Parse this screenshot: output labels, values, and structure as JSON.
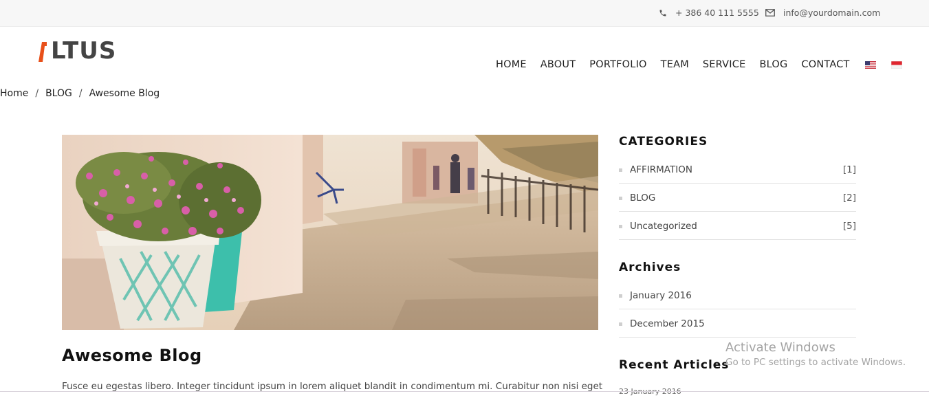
{
  "topbar": {
    "phone": "+ 386 40 111 5555",
    "email": "info@yourdomain.com"
  },
  "logo": {
    "text": "LTUS"
  },
  "nav": {
    "items": [
      "HOME",
      "ABOUT",
      "PORTFOLIO",
      "TEAM",
      "SERVICE",
      "BLOG",
      "CONTACT"
    ]
  },
  "breadcrumb": {
    "home": "Home",
    "section": "BLOG",
    "current": "Awesome Blog",
    "separator": "/"
  },
  "post": {
    "title": "Awesome Blog",
    "excerpt": "Fusce eu egestas libero. Integer tincidunt ipsum in lorem aliquet blandit in condimentum mi. Curabitur non nisi eget"
  },
  "sidebar": {
    "categories_heading": "CATEGORIES",
    "categories": [
      {
        "label": "AFFIRMATION",
        "count": "[1]"
      },
      {
        "label": "BLOG",
        "count": "[2]"
      },
      {
        "label": "Uncategorized",
        "count": "[5]"
      }
    ],
    "archives_heading": "Archives",
    "archives": [
      {
        "label": "January 2016"
      },
      {
        "label": "December 2015"
      }
    ],
    "recent_heading": "Recent Articles",
    "recent_date": "23 January 2016"
  },
  "watermark": {
    "line1": "Activate Windows",
    "line2": "Go to PC settings to activate Windows."
  },
  "colors": {
    "accent": "#e8501a",
    "logo_text": "#444444",
    "topbar_bg": "#f7f7f7"
  }
}
